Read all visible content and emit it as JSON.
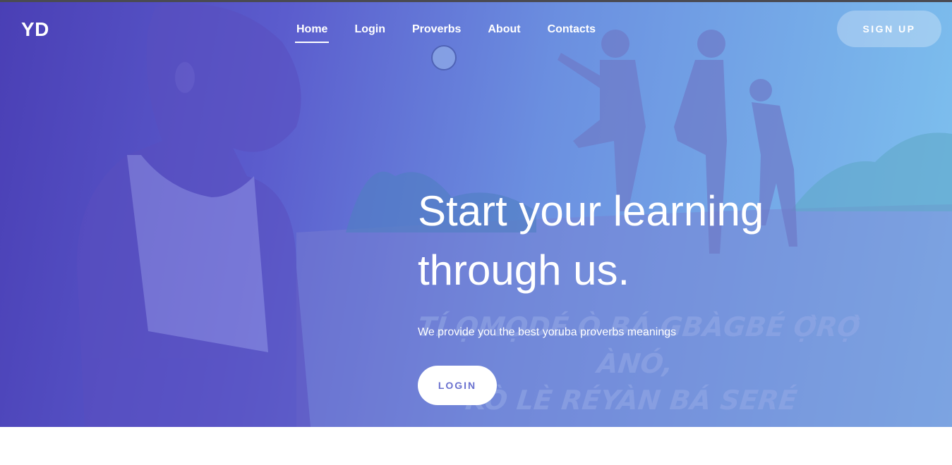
{
  "brand": {
    "logo_text": "YD"
  },
  "nav": {
    "items": [
      {
        "label": "Home",
        "active": true
      },
      {
        "label": "Login"
      },
      {
        "label": "Proverbs"
      },
      {
        "label": "About"
      },
      {
        "label": "Contacts"
      }
    ]
  },
  "header": {
    "signup_label": "SIGN UP"
  },
  "hero": {
    "headline": "Start your learning through us.",
    "subtext": "We provide you the best yoruba proverbs meanings",
    "login_label": "LOGIN",
    "background_proverb_line1": "TÍ ỌMỌDÉ Ò BÁ GBÀGBÉ Ọ̀RỌ̀ ÀNÓ,",
    "background_proverb_line2": "KÒ LÈ RÉYÀN BÁ SERÉ"
  },
  "colors": {
    "gradient_start": "#4a3fb5",
    "gradient_end": "#7ec3ef",
    "button_text": "#6a71cf"
  }
}
